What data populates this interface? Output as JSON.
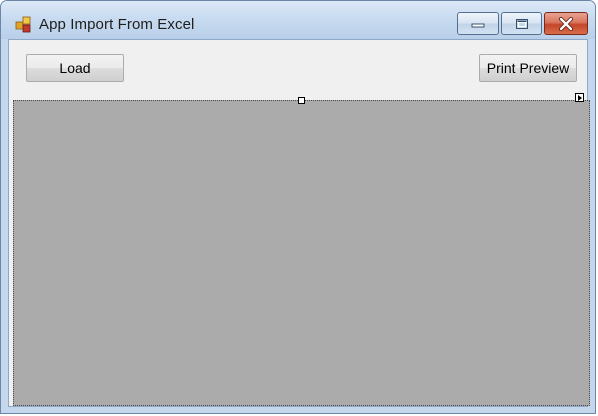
{
  "window": {
    "title": "App Import From Excel",
    "icon": "app-icon",
    "controls": {
      "minimize": "minimize-icon",
      "maximize": "maximize-icon",
      "close": "close-icon"
    }
  },
  "toolbar": {
    "load_label": "Load",
    "print_preview_label": "Print Preview"
  },
  "grid": {
    "name": "data-grid-view",
    "background": "#ababab"
  },
  "colors": {
    "titlebar": "#c8dbf0",
    "client": "#f0f0f0",
    "close_button": "#c4462a"
  }
}
